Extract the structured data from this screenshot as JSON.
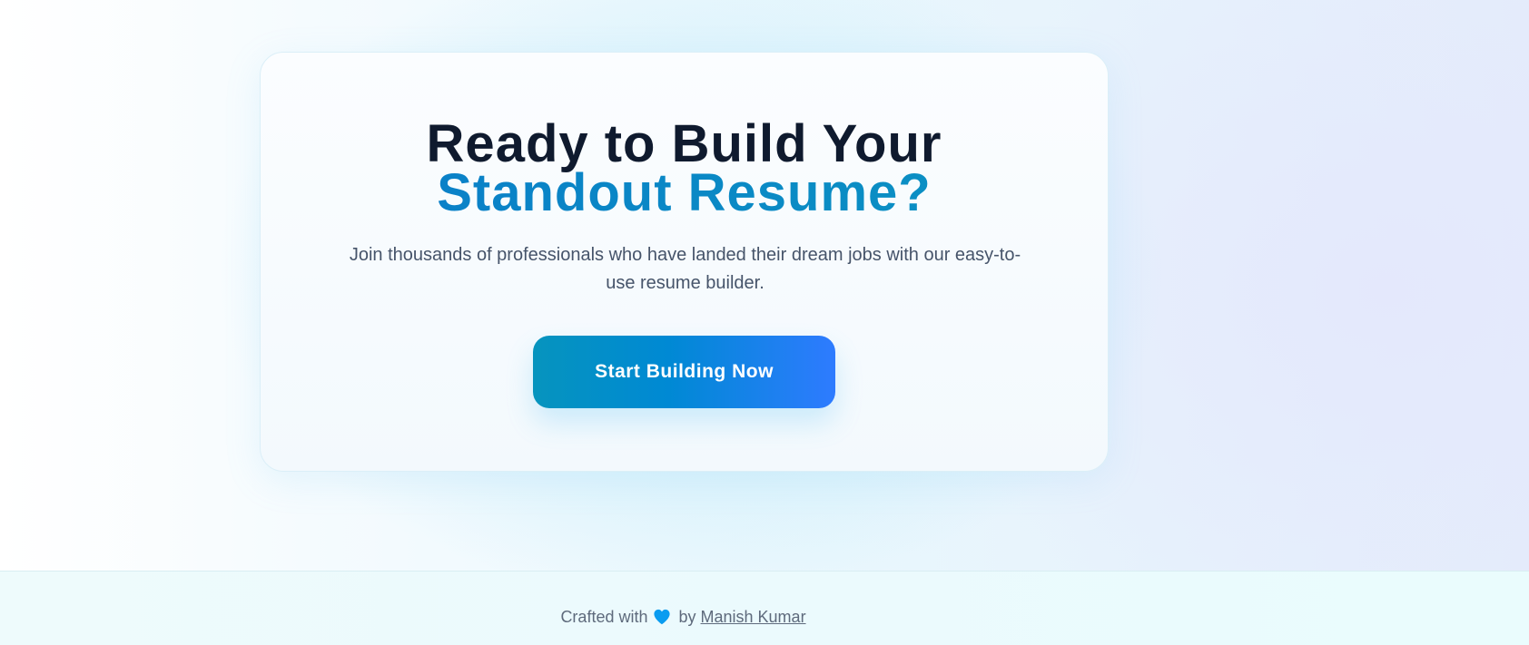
{
  "cta": {
    "title_line1": "Ready to Build Your",
    "title_line2": "Standout Resume?",
    "subtitle": "Join thousands of professionals who have landed their dream jobs with our easy-to-use resume builder.",
    "button_label": "Start Building Now"
  },
  "footer": {
    "crafted_with": "Crafted with",
    "heart_icon": "heart-icon",
    "by": "by",
    "author_name": "Manish Kumar"
  },
  "colors": {
    "title_dark": "#0f1a2e",
    "title_accent": "#0a86c4",
    "button_gradient_start": "#0694be",
    "button_gradient_end": "#2e7bff",
    "heart": "#0a9cf0"
  }
}
